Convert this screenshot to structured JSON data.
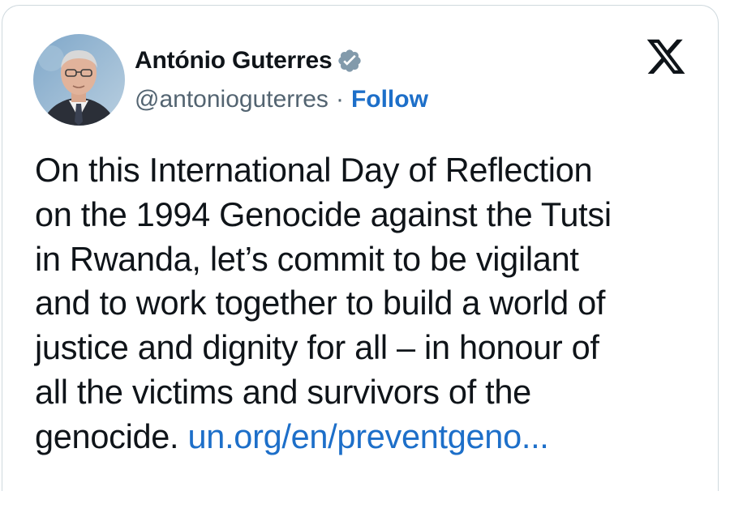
{
  "author": {
    "display_name": "António Guterres",
    "handle": "@antonioguterres",
    "separator": "·",
    "follow_label": "Follow",
    "verified": true,
    "avatar_icon": "profile-photo"
  },
  "platform_icon": "x-logo-icon",
  "tweet": {
    "lines": [
      "On this International Day of Reflection",
      "on the 1994 Genocide against the Tutsi",
      "in Rwanda, let’s commit to be vigilant",
      "and to work together to build a world of",
      "justice and dignity for all – in honour of",
      "all the victims and survivors of the",
      "genocide. "
    ],
    "link_text": "un.org/en/preventgeno..."
  },
  "colors": {
    "link": "#1d6fc9",
    "verified_badge": "#829aab",
    "text": "#0f1419",
    "secondary_text": "#536471",
    "border": "#cfd9de"
  }
}
